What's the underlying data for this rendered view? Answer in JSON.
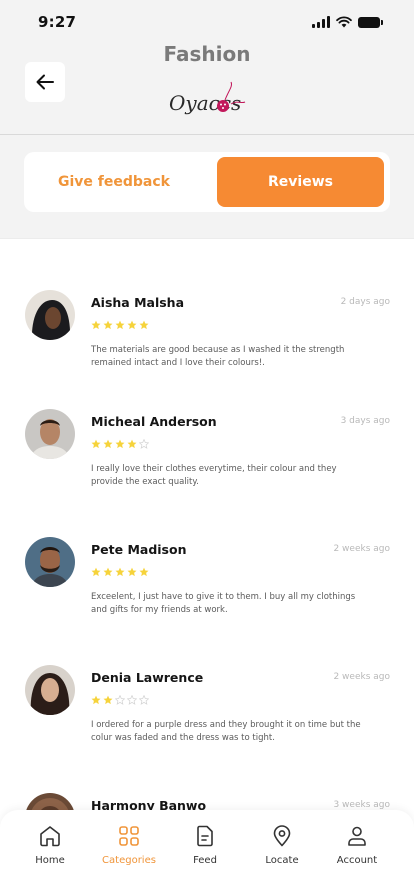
{
  "status_bar": {
    "time": "9:27"
  },
  "header": {
    "title": "Fashion",
    "logo_text": "Oyaccs"
  },
  "tabs": {
    "give_feedback": "Give feedback",
    "reviews": "Reviews",
    "active": "reviews"
  },
  "colors": {
    "accent": "#f68a33",
    "star": "#f6d33b",
    "star_empty": "#d6d6d6",
    "logo_pink": "#c2185b"
  },
  "reviews": [
    {
      "name": "Aisha Malsha",
      "date": "2 days ago",
      "rating": 5,
      "text": "The materials are good because as I washed it the strength remained intact and I love their colours!."
    },
    {
      "name": "Micheal Anderson",
      "date": "3 days ago",
      "rating": 4,
      "text": "I really love their clothes everytime, their colour and they provide the exact quality."
    },
    {
      "name": "Pete Madison",
      "date": "2 weeks ago",
      "rating": 5,
      "text": "Exceelent, I just have to give it to them. I buy all my clothings and gifts for my friends at work."
    },
    {
      "name": "Denia Lawrence",
      "date": "2 weeks ago",
      "rating": 2,
      "text": "I ordered for a purple dress and they brought it on time but the colur was faded and the dress was to tight."
    },
    {
      "name": "Harmony Banwo",
      "date": "3 weeks ago",
      "rating": 0,
      "text": ""
    }
  ],
  "bottom_nav": [
    {
      "label": "Home",
      "icon": "home-icon",
      "active": false
    },
    {
      "label": "Categories",
      "icon": "categories-icon",
      "active": true
    },
    {
      "label": "Feed",
      "icon": "feed-icon",
      "active": false
    },
    {
      "label": "Locate",
      "icon": "location-icon",
      "active": false
    },
    {
      "label": "Account",
      "icon": "account-icon",
      "active": false
    }
  ]
}
